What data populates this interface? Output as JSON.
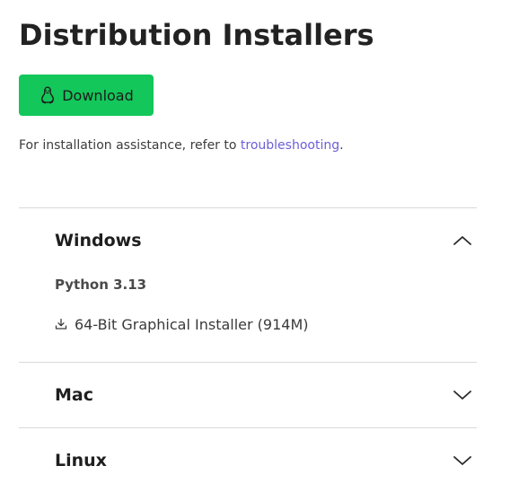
{
  "page": {
    "title": "Distribution Installers"
  },
  "download_button": {
    "label": "Download",
    "icon": "linux-penguin-icon",
    "color": "#13c75a"
  },
  "assistance": {
    "prefix": "For installation assistance, refer to ",
    "link_text": "troubleshooting",
    "suffix": ".",
    "link_color": "#6a5fd6"
  },
  "sections": [
    {
      "title": "Windows",
      "expanded": true,
      "chevron": "chevron-up-icon",
      "version": "Python 3.13",
      "installers": [
        {
          "label": "64-Bit Graphical Installer (914M)",
          "icon": "download-icon"
        }
      ]
    },
    {
      "title": "Mac",
      "expanded": false,
      "chevron": "chevron-down-icon"
    },
    {
      "title": "Linux",
      "expanded": false,
      "chevron": "chevron-down-icon"
    }
  ]
}
